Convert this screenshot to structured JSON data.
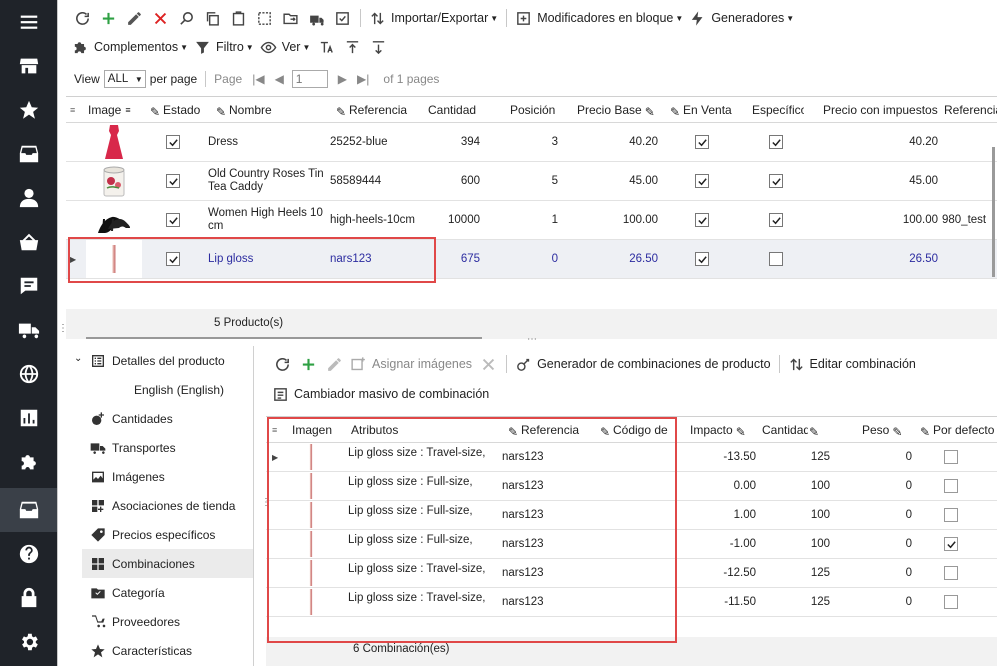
{
  "toolbar1": {
    "import_export": "Importar/Exportar",
    "bulk": "Modificadores en bloque",
    "generators": "Generadores"
  },
  "toolbar2": {
    "addons": "Complementos",
    "filter": "Filtro",
    "view": "Ver"
  },
  "pager": {
    "view_label": "View",
    "view_value": "ALL",
    "per_page": "per page",
    "page_label": "Page",
    "page_value": "1",
    "of_pages": "of 1 pages"
  },
  "products": {
    "columns": [
      "Image",
      "Estado",
      "Nombre",
      "Referencia",
      "Cantidad",
      "Posición",
      "Precio Base",
      "En Venta",
      "Específico",
      "Precio con impuestos",
      "Referencia"
    ],
    "rows": [
      {
        "name": "Dress",
        "ref": "25252-blue",
        "qty": "394",
        "pos": "3",
        "price": "40.20",
        "sale": true,
        "spec": true,
        "price_tax": "40.20",
        "ref2": ""
      },
      {
        "name": "Old Country Roses Tin Tea Caddy",
        "ref": "58589444",
        "qty": "600",
        "pos": "5",
        "price": "45.00",
        "sale": true,
        "spec": true,
        "price_tax": "45.00",
        "ref2": ""
      },
      {
        "name": "Women High Heels 10 cm",
        "ref": "high-heels-10cm",
        "qty": "10000",
        "pos": "1",
        "price": "100.00",
        "sale": true,
        "spec": true,
        "price_tax": "100.00",
        "ref2": "980_test"
      },
      {
        "name": "Lip gloss",
        "ref": "nars123",
        "qty": "675",
        "pos": "0",
        "price": "26.50",
        "sale": true,
        "spec": false,
        "price_tax": "26.50",
        "ref2": ""
      }
    ],
    "footer": "5 Producto(s)"
  },
  "tree": {
    "details": "Detalles del producto",
    "language": "English (English)",
    "items": [
      "Cantidades",
      "Transportes",
      "Imágenes",
      "Asociaciones de tienda",
      "Precios específicos",
      "Combinaciones",
      "Categoría",
      "Proveedores",
      "Características"
    ]
  },
  "combo_toolbar": {
    "assign_images": "Asignar imágenes",
    "generator": "Generador de combinaciones de producto",
    "edit": "Editar combinación",
    "bulk_changer": "Cambiador masivo de combinación"
  },
  "combos": {
    "columns": [
      "Imagen",
      "Atributos",
      "Referencia",
      "Código de",
      "Impacto",
      "Cantidad",
      "Peso",
      "Por defecto"
    ],
    "rows": [
      {
        "attr": "Lip gloss size : Travel-size,",
        "ref": "nars123",
        "impact": "-13.50",
        "qty": "125",
        "weight": "0",
        "def": false
      },
      {
        "attr": "Lip gloss size : Full-size,",
        "ref": "nars123",
        "impact": "0.00",
        "qty": "100",
        "weight": "0",
        "def": false
      },
      {
        "attr": "Lip gloss size : Full-size,",
        "ref": "nars123",
        "impact": "1.00",
        "qty": "100",
        "weight": "0",
        "def": false
      },
      {
        "attr": "Lip gloss size : Full-size,",
        "ref": "nars123",
        "impact": "-1.00",
        "qty": "100",
        "weight": "0",
        "def": true
      },
      {
        "attr": "Lip gloss size : Travel-size,",
        "ref": "nars123",
        "impact": "-12.50",
        "qty": "125",
        "weight": "0",
        "def": false
      },
      {
        "attr": "Lip gloss size : Travel-size,",
        "ref": "nars123",
        "impact": "-11.50",
        "qty": "125",
        "weight": "0",
        "def": false
      }
    ],
    "footer": "6 Combinación(es)"
  },
  "colors": {
    "highlight": "#e04848",
    "selected_text": "#2c2ca0",
    "add_green": "#2ea043",
    "delete_red": "#d22"
  }
}
